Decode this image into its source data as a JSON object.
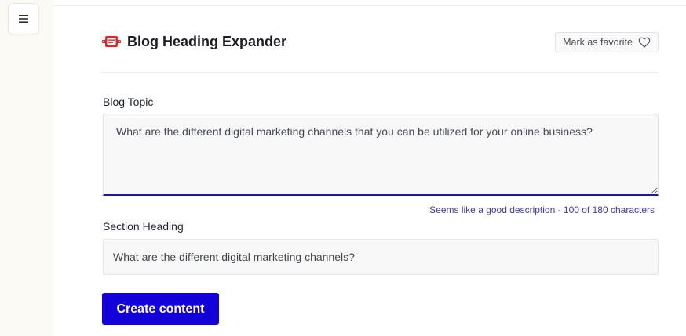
{
  "sidebar": {
    "menu_icon": "hamburger-menu-icon"
  },
  "header": {
    "title": "Blog Heading Expander",
    "app_icon": "heading-expander-icon",
    "favorite_label": "Mark as favorite",
    "favorite_icon": "heart-outline-icon"
  },
  "form": {
    "blog_topic": {
      "label": "Blog Topic",
      "value": "What are the different digital marketing channels that you can be utilized for your online business?",
      "helper": "Seems like a good description - 100 of 180 characters"
    },
    "section_heading": {
      "label": "Section Heading",
      "value": "What are the different digital marketing channels?"
    },
    "submit_label": "Create content"
  },
  "colors": {
    "primary": "#1300d9",
    "focus_underline": "#1d1a9c",
    "helper_text": "#3e3ab0",
    "sidebar_bg": "#fbfaf5",
    "icon_red": "#e0262b"
  }
}
